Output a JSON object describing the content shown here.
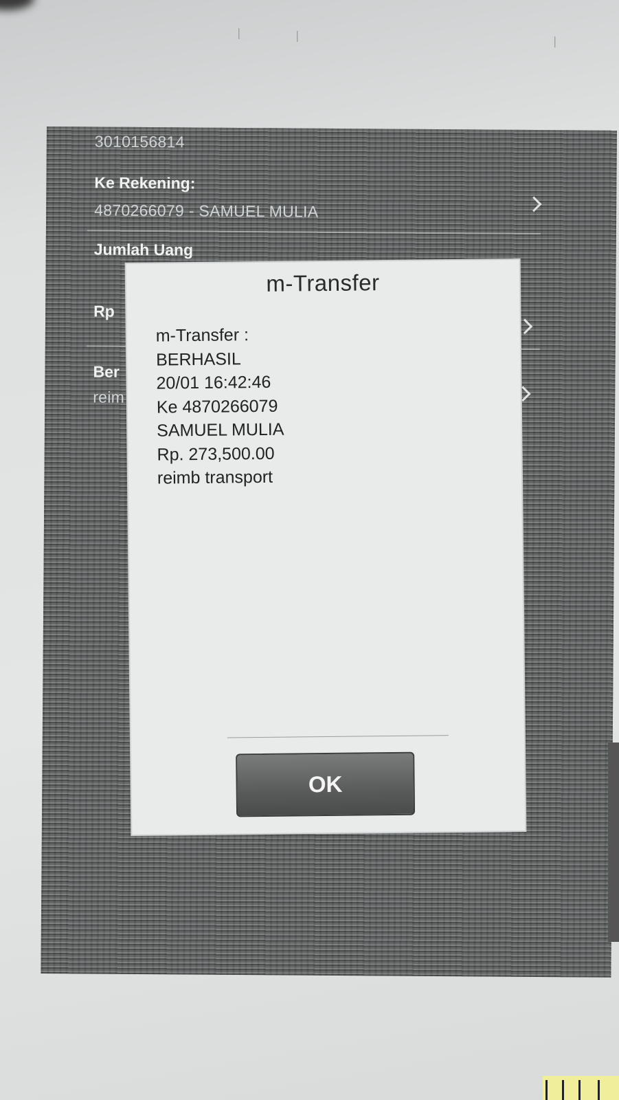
{
  "background_form": {
    "from_account_value": "3010156814",
    "to_account_label": "Ke Rekening:",
    "to_account_value": "4870266079 - SAMUEL MULIA",
    "amount_label": "Jumlah Uang",
    "currency_prefix": "Rp",
    "news_label_partial": "Ber",
    "news_value_partial": "reim"
  },
  "dialog": {
    "title": "m-Transfer",
    "lines": [
      "m-Transfer :",
      "BERHASIL",
      "20/01 16:42:46",
      "Ke 4870266079",
      "SAMUEL MULIA",
      "Rp. 273,500.00",
      "reimb transport"
    ],
    "ok_label": "OK"
  }
}
